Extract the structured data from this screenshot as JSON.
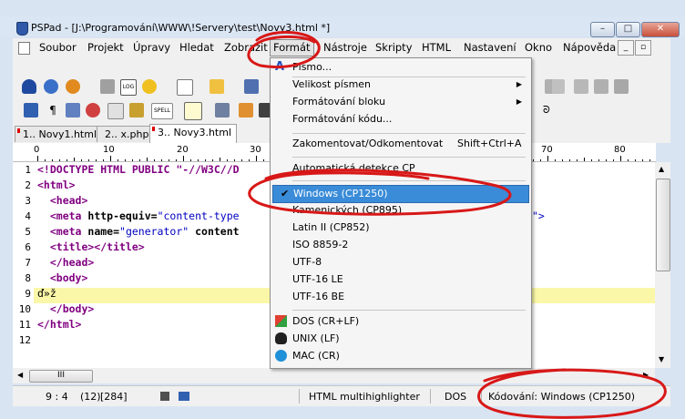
{
  "window": {
    "title": "PSPad - [J:\\Programování\\WWW\\!Servery\\test\\Novy3.html *]",
    "controls": {
      "minimize": "–",
      "maximize": "□",
      "close": "✕"
    }
  },
  "menubar": {
    "items": [
      "Soubor",
      "Projekt",
      "Úpravy",
      "Hledat",
      "Zobrazit",
      "Formát",
      "Nástroje",
      "Skripty",
      "HTML",
      "Nastavení",
      "Okno",
      "Nápověda"
    ],
    "active": "Formát",
    "mdi_close": "✕"
  },
  "tabs": [
    {
      "label": "1.. Novy1.html"
    },
    {
      "label": "2.. x.php"
    },
    {
      "label": "3.. Novy3.html"
    }
  ],
  "ruler": {
    "labels": [
      "0",
      "10",
      "20",
      "30",
      "70",
      "80"
    ]
  },
  "editor": {
    "line_numbers": [
      "1",
      "2",
      "3",
      "4",
      "5",
      "6",
      "7",
      "8",
      "9",
      "10",
      "11",
      "12"
    ],
    "lines": [
      {
        "tag": "<!DOCTYPE HTML PUBLIC \"-//W3C//D",
        "rest": ""
      },
      {
        "tag": "<html>",
        "rest": ""
      },
      {
        "tag": "  <head>",
        "rest": ""
      },
      {
        "tag": "  <meta",
        "attr": " http-equiv=",
        "str": "\"content-type",
        "rest": ""
      },
      {
        "tag": "  <meta",
        "attr": " name=",
        "str": "\"generator\"",
        "attr2": " content",
        "rest": ""
      },
      {
        "tag": "  <title></title>",
        "rest": ""
      },
      {
        "tag": "  </head>",
        "rest": ""
      },
      {
        "tag": "  <body>",
        "rest": ""
      },
      {
        "text": "ď»ž"
      },
      {
        "tag": "  </body>",
        "rest": ""
      },
      {
        "tag": "</html>",
        "rest": ""
      },
      {
        "text": ""
      }
    ],
    "code_tail_right": "\">"
  },
  "scrollbar": {
    "hthumb_grip": "III"
  },
  "statusbar": {
    "position": "9 : 4",
    "column": "(12)",
    "size": "[284]",
    "highlighter": "HTML multihighlighter",
    "line_ending": "DOS",
    "encoding": "Kódování: Windows (CP1250)"
  },
  "format_menu": {
    "items": [
      {
        "label": "Písmo...",
        "icon": "font-a-icon"
      },
      {
        "label": "Velikost písmen",
        "submenu": true
      },
      {
        "label": "Formátování bloku",
        "submenu": true
      },
      {
        "label": "Formátování kódu...",
        "submenu": false
      },
      {
        "label": "Zakomentovat/Odkomentovat",
        "shortcut": "Shift+Ctrl+A"
      },
      {
        "label": "Automatická detekce CP"
      },
      {
        "label": "Windows (CP1250)",
        "checked": true
      },
      {
        "label": "Kamenických (CP895)"
      },
      {
        "label": "Latin II (CP852)"
      },
      {
        "label": "ISO 8859-2"
      },
      {
        "label": "UTF-8"
      },
      {
        "label": "UTF-16 LE"
      },
      {
        "label": "UTF-16 BE"
      },
      {
        "label": "DOS  (CR+LF)",
        "icon": "windows-icon"
      },
      {
        "label": "UNIX  (LF)",
        "icon": "linux-penguin-icon"
      },
      {
        "label": "MAC  (CR)",
        "icon": "apple-icon"
      }
    ],
    "submenu_arrow": "▶",
    "check_mark": "✔"
  },
  "colors": {
    "tag": "#800080",
    "string": "#0000c0",
    "highlight_line": "#fbf7a8",
    "selection": "#3a8cd8",
    "annotation": "#d81818"
  }
}
